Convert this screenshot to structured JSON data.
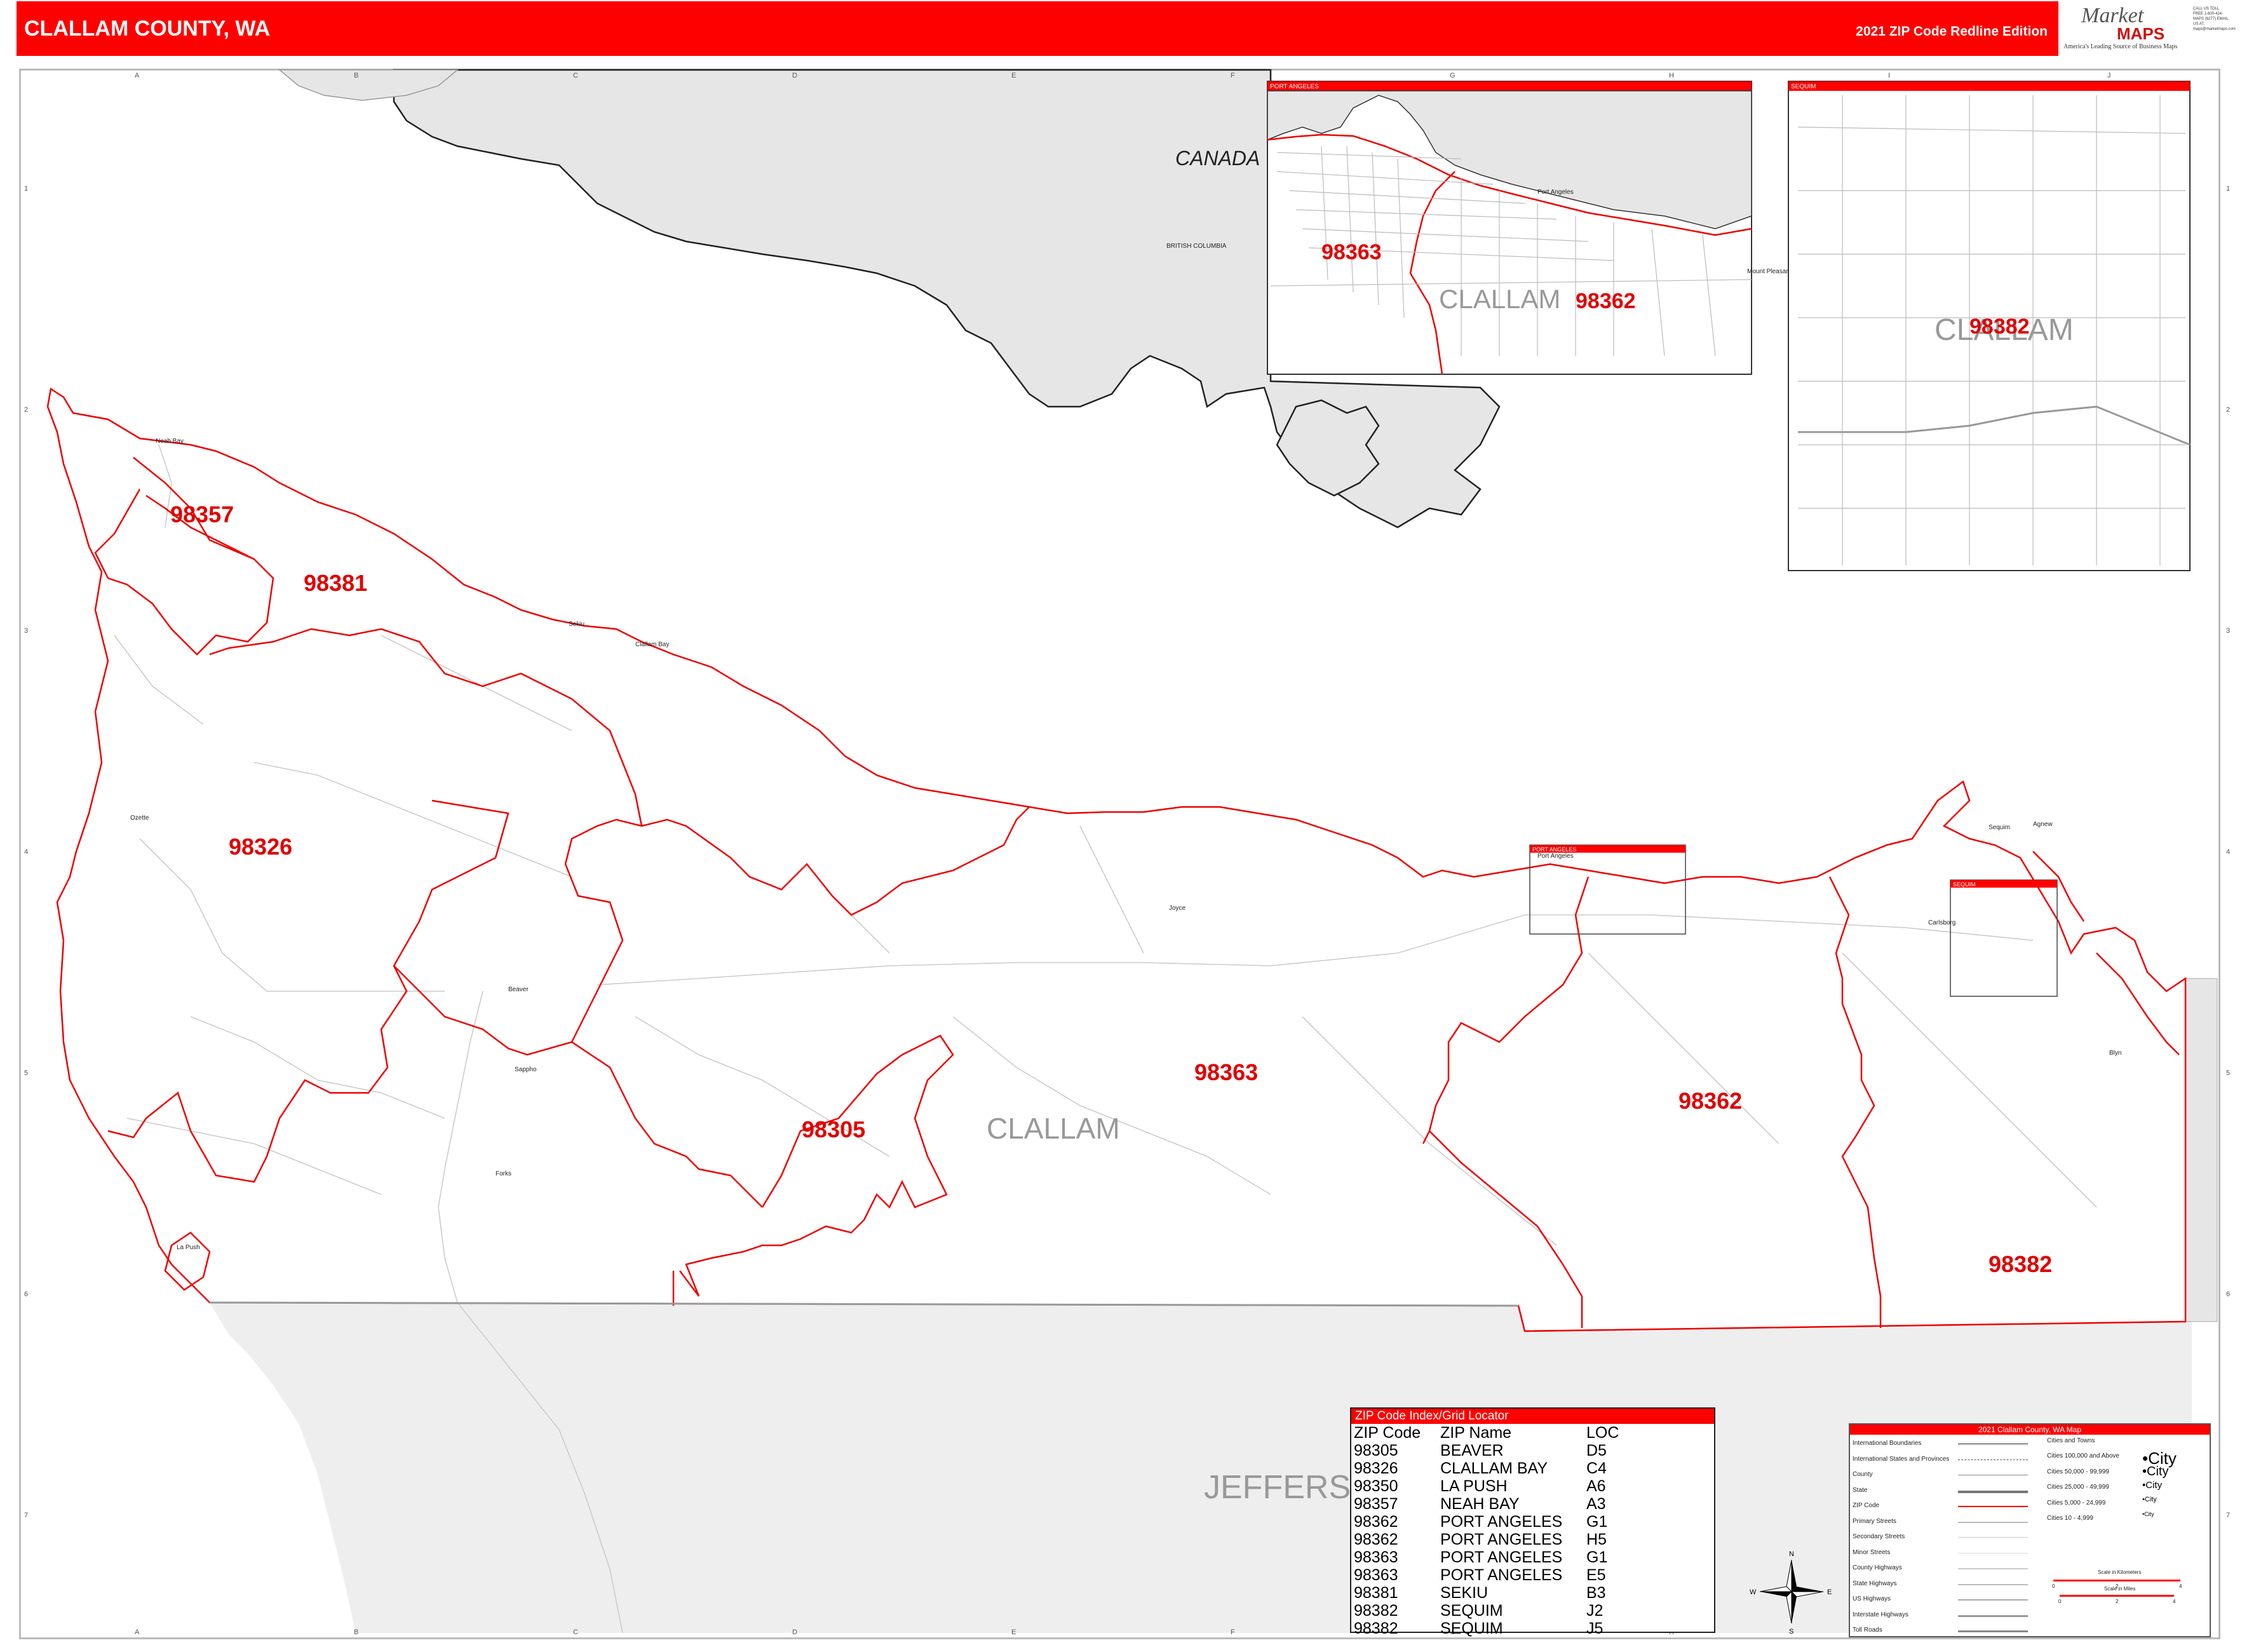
{
  "header": {
    "title": "CLALLAM COUNTY, WA",
    "edition": "2021 ZIP Code Redline Edition",
    "logo_main": "Market",
    "logo_maps": "MAPS",
    "logo_tagline": "America's Leading Source of Business Maps",
    "logo_contact": "CALL US TOLL FREE 1-800-424-MAPS (6277) EMAIL US AT: maps@marketmaps.com"
  },
  "grid": {
    "columns": [
      "A",
      "B",
      "C",
      "D",
      "E",
      "F",
      "G",
      "H",
      "I",
      "J"
    ],
    "rows": [
      "1",
      "2",
      "3",
      "4",
      "5",
      "6",
      "7"
    ]
  },
  "labels": {
    "country": "CANADA",
    "province": "BRITISH COLUMBIA",
    "county_main": "CLALLAM",
    "county_neighbor": "JEFFERSON",
    "inset_pa_county": "CLALLAM",
    "inset_sequim_county": "CLALLAM",
    "inset_pa_title": "PORT ANGELES",
    "inset_sequim_title": "SEQUIM",
    "inset_box_pa": "PORT ANGELES",
    "inset_box_sequim": "SEQUIM",
    "places": [
      "Neah Bay",
      "Sekiu",
      "Clallam Bay",
      "Ozette",
      "Beaver",
      "Sappho",
      "Forks",
      "La Push",
      "Joyce",
      "Port Angeles",
      "Mount Pleasant",
      "Carlsborg",
      "Sequim",
      "Blyn",
      "Agnew"
    ]
  },
  "zip_labels": [
    "98357",
    "98381",
    "98326",
    "98305",
    "98363",
    "98362",
    "98382"
  ],
  "inset_zip_labels": {
    "pa": [
      "98363",
      "98362"
    ],
    "sequim": [
      "98382"
    ]
  },
  "index": {
    "title": "ZIP Code Index/Grid Locator",
    "headers": [
      "ZIP Code",
      "ZIP Name",
      "LOC"
    ],
    "rows": [
      [
        "98305",
        "BEAVER",
        "D5"
      ],
      [
        "98326",
        "CLALLAM BAY",
        "C4"
      ],
      [
        "98350",
        "LA PUSH",
        "A6"
      ],
      [
        "98357",
        "NEAH BAY",
        "A3"
      ],
      [
        "98362",
        "PORT ANGELES",
        "G1"
      ],
      [
        "98362",
        "PORT ANGELES",
        "H5"
      ],
      [
        "98363",
        "PORT ANGELES",
        "G1"
      ],
      [
        "98363",
        "PORT ANGELES",
        "E5"
      ],
      [
        "98381",
        "SEKIU",
        "B3"
      ],
      [
        "98382",
        "SEQUIM",
        "J2"
      ],
      [
        "98382",
        "SEQUIM",
        "J5"
      ]
    ]
  },
  "legend": {
    "title": "2021 Clallam County, WA Map",
    "items": [
      "International Boundaries",
      "International States and Provinces",
      "County",
      "State",
      "ZIP Code",
      "Primary Streets",
      "Secondary Streets",
      "Minor Streets",
      "County Highways",
      "State Highways",
      "US Highways",
      "Interstate Highways",
      "Toll Roads"
    ],
    "cities_header": "Cities and Towns",
    "city_classes": [
      "Cities 100,000 and Above",
      "Cities 50,000 - 99,999",
      "Cities 25,000 - 49,999",
      "Cities 5,000 - 24,999",
      "Cities 10 - 4,999"
    ],
    "city_samples": [
      "City",
      "City",
      "City",
      "City",
      "City"
    ],
    "scale_km": "Scale in Kilometers",
    "scale_mi": "Scale in Miles",
    "scale_km_ticks": [
      "0",
      "2",
      "4"
    ],
    "scale_mi_ticks": [
      "0",
      "2",
      "4"
    ],
    "compass": [
      "N",
      "E",
      "S",
      "W"
    ]
  },
  "colors": {
    "brand_red": "#ff0000",
    "zip_red": "#e00000",
    "water_land_gray": "#e8e8e8",
    "road_gray": "#c8c8c8"
  }
}
